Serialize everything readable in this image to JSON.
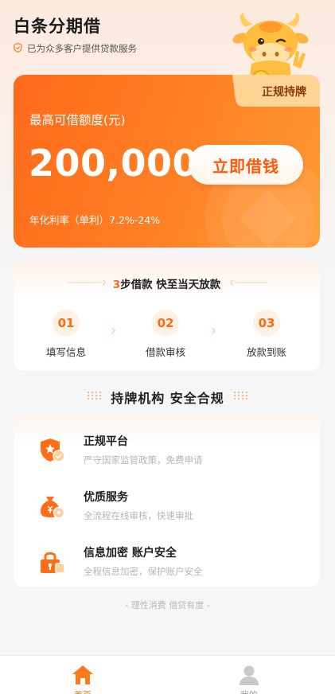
{
  "header": {
    "app_title": "白条分期借",
    "subtitle": "已为众多客户提供贷款服务",
    "shield_icon": "shield-check-icon",
    "mascot": "cow-mascot-icon"
  },
  "hero": {
    "licensed_badge": "正规持牌",
    "limit_label": "最高可借额度(元)",
    "limit_amount": "200,000",
    "borrow_button": "立即借钱",
    "rate_text": "年化利率（单利）7.2%-24%"
  },
  "steps": {
    "heading_num": "3",
    "heading_rest": "步借款  快至当天放款",
    "items": [
      {
        "number": "01",
        "label": "填写信息"
      },
      {
        "number": "02",
        "label": "借款审核"
      },
      {
        "number": "03",
        "label": "放款到账"
      }
    ]
  },
  "compliance": {
    "title": "持牌机构 安全合规",
    "features": [
      {
        "icon": "shield-star-icon",
        "title": "正规平台",
        "desc": "严守国家监管政策，免费申请"
      },
      {
        "icon": "money-bag-icon",
        "title": "优质服务",
        "desc": "全流程在线审核，快速审批"
      },
      {
        "icon": "lock-icon",
        "title": "信息加密 账户安全",
        "desc": "全程信息加密，保护账户安全"
      }
    ]
  },
  "footer": {
    "tagline": "- 理性消费 借贷有度 -"
  },
  "tabbar": {
    "items": [
      {
        "label": "首页",
        "icon": "home-icon",
        "active": true
      },
      {
        "label": "我的",
        "icon": "user-icon",
        "active": false
      }
    ]
  },
  "colors": {
    "accent": "#ff6a12",
    "hero_start": "#ff6a1a",
    "hero_end": "#ff9a33",
    "badge_gold": "#ffd28a"
  }
}
